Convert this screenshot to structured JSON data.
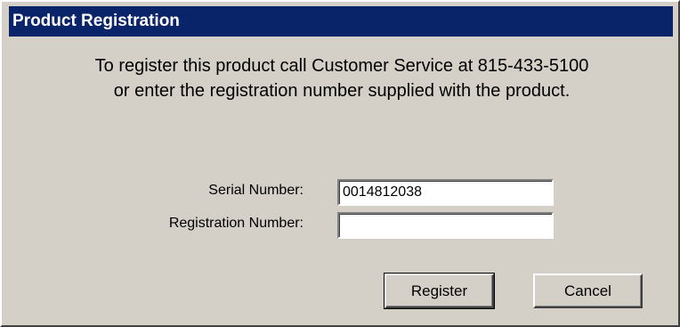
{
  "window": {
    "title": "Product Registration"
  },
  "message": {
    "line1": "To register this product call Customer Service at 815-433-5100",
    "line2": "or enter the registration number supplied with the product."
  },
  "form": {
    "serial_label": "Serial Number:",
    "serial_value": "0014812038",
    "registration_label": "Registration Number:",
    "registration_value": ""
  },
  "buttons": {
    "register": "Register",
    "cancel": "Cancel"
  },
  "colors": {
    "titlebar": "#0a246a",
    "dialog_face": "#d4d0c8"
  }
}
